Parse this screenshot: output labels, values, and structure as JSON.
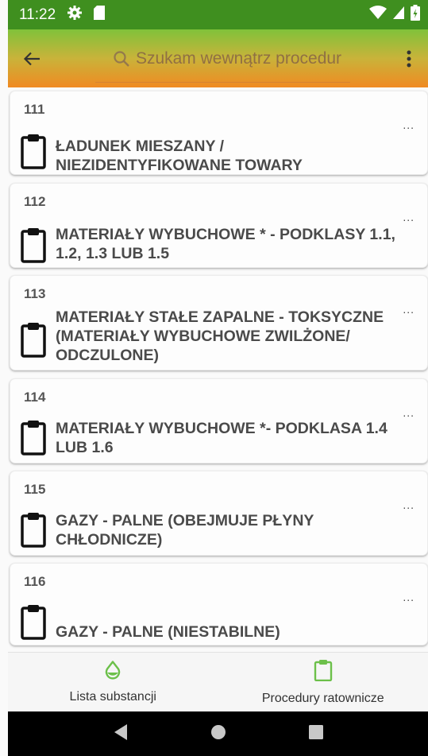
{
  "status": {
    "time": "11:22"
  },
  "search": {
    "placeholder": "Szukam wewnątrz procedur"
  },
  "list": {
    "items": [
      {
        "number": "111",
        "title": "ŁADUNEK MIESZANY / NIEZIDENTYFIKOWANE TOWARY",
        "more": "..."
      },
      {
        "number": "112",
        "title": "MATERIAŁY WYBUCHOWE * - PODKLASY 1.1, 1.2, 1.3 LUB 1.5",
        "more": "..."
      },
      {
        "number": "113",
        "title": "MATERIAŁY STAŁE ZAPALNE - TOKSYCZNE (MATERIAŁY WYBUCHOWE ZWILŻONE/ ODCZULONE)",
        "more": "..."
      },
      {
        "number": "114",
        "title": "MATERIAŁY WYBUCHOWE *- PODKLASA 1.4 LUB 1.6",
        "more": "..."
      },
      {
        "number": "115",
        "title": "GAZY - PALNE (OBEJMUJE PŁYNY CHŁODNICZE)",
        "more": "..."
      },
      {
        "number": "116",
        "title": "GAZY - PALNE (NIESTABILNE)",
        "more": "..."
      }
    ]
  },
  "bottomnav": {
    "items": [
      {
        "label": "Lista substancji",
        "icon": "drop-icon"
      },
      {
        "label": "Procedury ratownicze",
        "icon": "clipboard-icon"
      }
    ]
  },
  "colors": {
    "statusbar": "#3f8f1f",
    "accent": "#6cc04a",
    "appbar_top": "#80c23a",
    "appbar_bottom": "#f08a22"
  }
}
